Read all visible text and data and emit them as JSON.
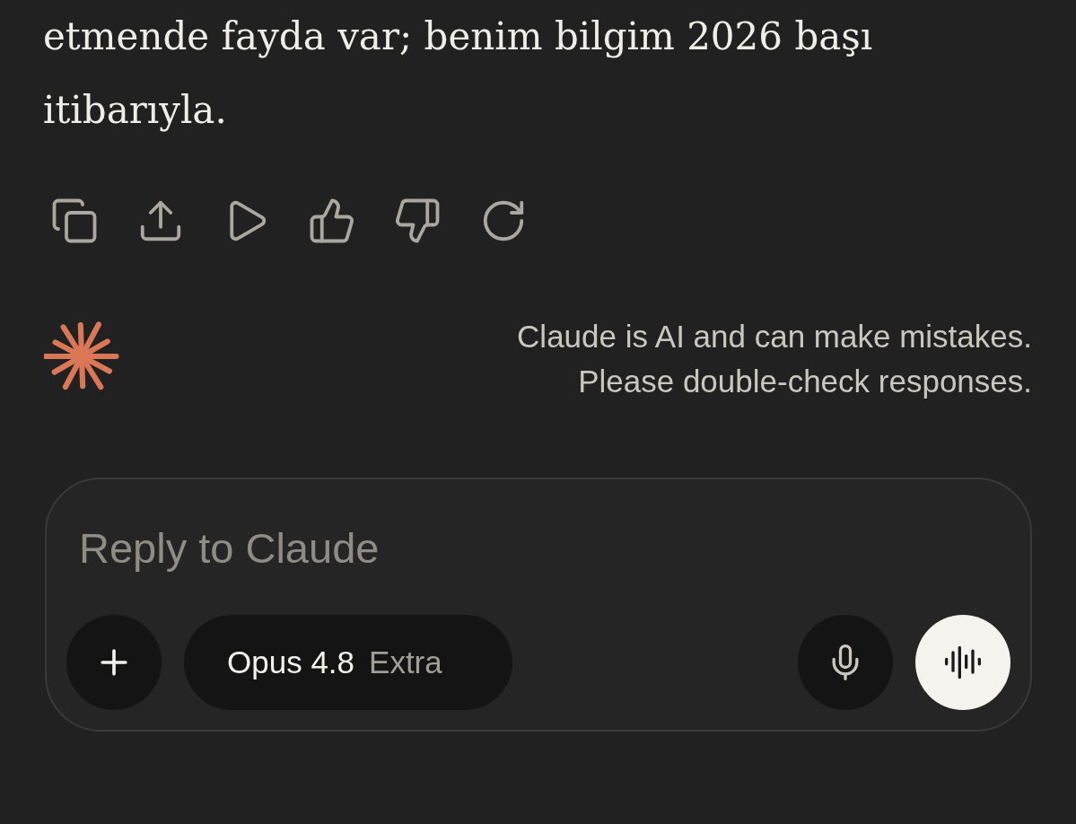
{
  "message": {
    "text": "etmende fayda var; benim bilgim 2026 başı itibarıyla."
  },
  "disclaimer": {
    "lines": [
      "Claude is AI and can make mistakes.",
      "Please double-check responses."
    ]
  },
  "composer": {
    "placeholder": "Reply to Claude",
    "model": {
      "name": "Opus 4.8",
      "mode": "Extra"
    }
  }
}
